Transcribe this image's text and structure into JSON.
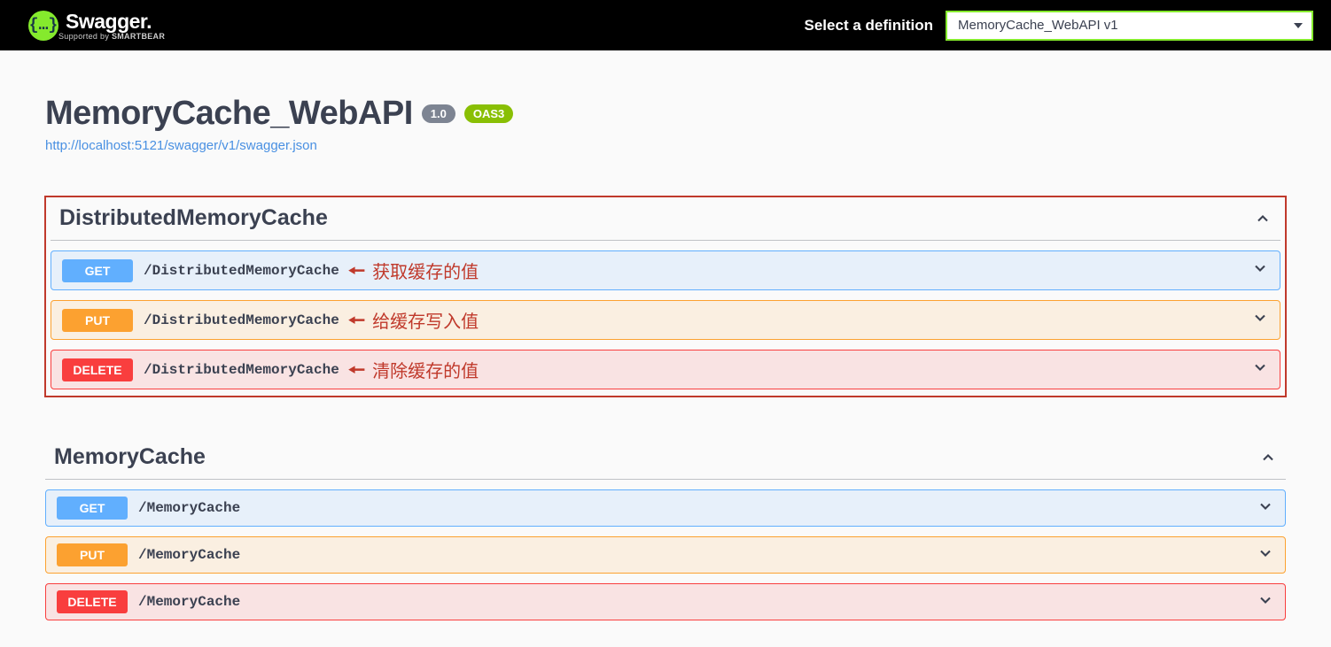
{
  "topbar": {
    "logo_glyph": "{…}",
    "logo_text": "Swagger.",
    "logo_sub_prefix": "Supported by ",
    "logo_sub_bold": "SMARTBEAR",
    "def_label": "Select a definition",
    "def_value": "MemoryCache_WebAPI v1"
  },
  "header": {
    "title": "MemoryCache_WebAPI",
    "version": "1.0",
    "oas": "OAS3",
    "spec_url": "http://localhost:5121/swagger/v1/swagger.json"
  },
  "tags": [
    {
      "name": "DistributedMemoryCache",
      "highlighted": true,
      "ops": [
        {
          "method": "GET",
          "path": "/DistributedMemoryCache",
          "annotation": "获取缓存的值"
        },
        {
          "method": "PUT",
          "path": "/DistributedMemoryCache",
          "annotation": "给缓存写入值"
        },
        {
          "method": "DELETE",
          "path": "/DistributedMemoryCache",
          "annotation": "清除缓存的值"
        }
      ]
    },
    {
      "name": "MemoryCache",
      "highlighted": false,
      "ops": [
        {
          "method": "GET",
          "path": "/MemoryCache"
        },
        {
          "method": "PUT",
          "path": "/MemoryCache"
        },
        {
          "method": "DELETE",
          "path": "/MemoryCache"
        }
      ]
    }
  ],
  "colors": {
    "get": "#61affe",
    "put": "#fca130",
    "delete": "#f93e3e",
    "accent": "#85ea2d",
    "annotation": "#c0392b"
  }
}
